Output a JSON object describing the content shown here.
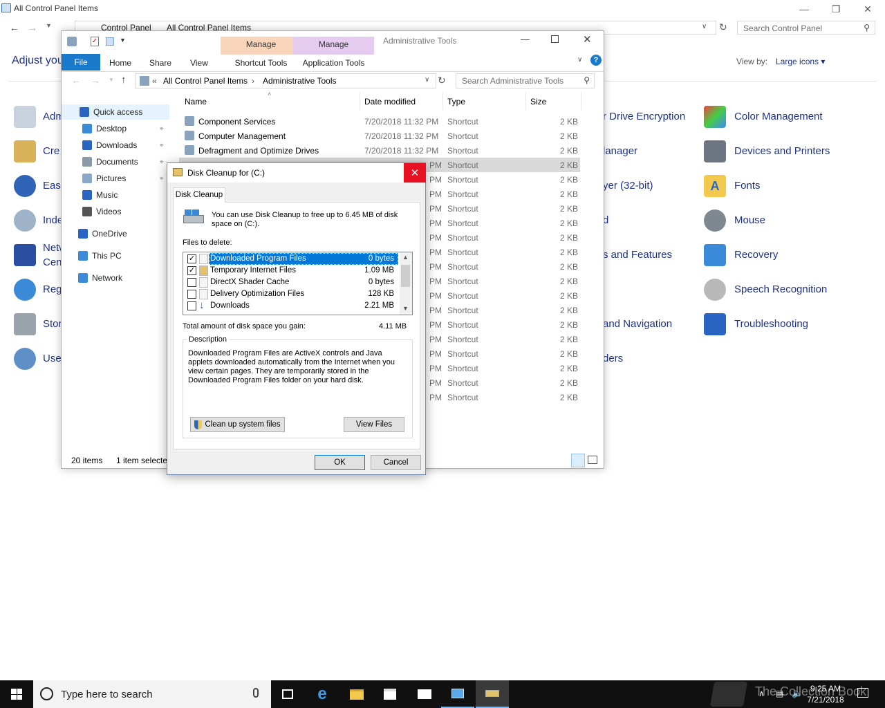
{
  "control_panel": {
    "title": "All Control Panel Items",
    "address": [
      "Control Panel",
      "All Control Panel Items"
    ],
    "search_placeholder": "Search Control Panel",
    "heading": "Adjust you",
    "view_by_label": "View by:",
    "view_by_value": "Large icons",
    "left_items": [
      "Adm",
      "Cre",
      "Ease",
      "Inde",
      "Netw",
      "Cen",
      "Reg",
      "Stor",
      "Use"
    ],
    "middle_items": [
      "r Drive Encryption",
      "lanager",
      "yer (32-bit)",
      "d",
      "s and Features",
      "and Navigation",
      "ders"
    ],
    "right_items": [
      "Color Management",
      "Devices and Printers",
      "Fonts",
      "Mouse",
      "Recovery",
      "Speech Recognition",
      "Troubleshooting"
    ]
  },
  "explorer": {
    "title": "Administrative Tools",
    "context_tabs": [
      {
        "label": "Manage",
        "sub": "Shortcut Tools",
        "color": "#f9d6bb"
      },
      {
        "label": "Manage",
        "sub": "Application Tools",
        "color": "#e6cbf1"
      }
    ],
    "tabs": [
      "File",
      "Home",
      "Share",
      "View"
    ],
    "address": [
      "All Control Panel Items",
      "Administrative Tools"
    ],
    "search_placeholder": "Search Administrative Tools",
    "nav": [
      {
        "label": "Quick access",
        "icon": "star-icon"
      },
      {
        "label": "Desktop",
        "icon": "desktop-icon"
      },
      {
        "label": "Downloads",
        "icon": "download-icon"
      },
      {
        "label": "Documents",
        "icon": "documents-icon"
      },
      {
        "label": "Pictures",
        "icon": "pictures-icon"
      },
      {
        "label": "Music",
        "icon": "music-icon"
      },
      {
        "label": "Videos",
        "icon": "videos-icon"
      },
      {
        "label": "OneDrive",
        "icon": "cloud-icon"
      },
      {
        "label": "This PC",
        "icon": "pc-icon"
      },
      {
        "label": "Network",
        "icon": "network-icon"
      }
    ],
    "columns": [
      "Name",
      "Date modified",
      "Type",
      "Size"
    ],
    "rows": [
      {
        "name": "Component Services",
        "date": "7/20/2018 11:32 PM",
        "type": "Shortcut",
        "size": "2 KB"
      },
      {
        "name": "Computer Management",
        "date": "7/20/2018 11:32 PM",
        "type": "Shortcut",
        "size": "2 KB"
      },
      {
        "name": "Defragment and Optimize Drives",
        "date": "7/20/2018 11:32 PM",
        "type": "Shortcut",
        "size": "2 KB"
      }
    ],
    "partial_rows": [
      {
        "date": "PM",
        "type": "Shortcut",
        "size": "2 KB"
      }
    ],
    "status_count": "20 items",
    "status_selected": "1 item selecte"
  },
  "dialog": {
    "title": "Disk Cleanup for  (C:)",
    "tab": "Disk Cleanup",
    "intro": "You can use Disk Cleanup to free up to 6.45 MB of disk space on  (C:).",
    "files_label": "Files to delete:",
    "files": [
      {
        "name": "Downloaded Program Files",
        "size": "0 bytes",
        "checked": true,
        "selected": true
      },
      {
        "name": "Temporary Internet Files",
        "size": "1.09 MB",
        "checked": true,
        "selected": false
      },
      {
        "name": "DirectX Shader Cache",
        "size": "0 bytes",
        "checked": false,
        "selected": false
      },
      {
        "name": "Delivery Optimization Files",
        "size": "128 KB",
        "checked": false,
        "selected": false
      },
      {
        "name": "Downloads",
        "size": "2.21 MB",
        "checked": false,
        "selected": false
      }
    ],
    "total_label": "Total amount of disk space you gain:",
    "total_value": "4.11 MB",
    "description_label": "Description",
    "description": "Downloaded Program Files are ActiveX controls and Java applets downloaded automatically from the Internet when you view certain pages. They are temporarily stored in the Downloaded Program Files folder on your hard disk.",
    "cleanup_button": "Clean up system files",
    "view_files_button": "View Files",
    "ok": "OK",
    "cancel": "Cancel"
  },
  "taskbar": {
    "search_placeholder": "Type here to search",
    "time": "9:25 AM",
    "date": "7/21/2018",
    "watermark": "The Collection Book"
  }
}
